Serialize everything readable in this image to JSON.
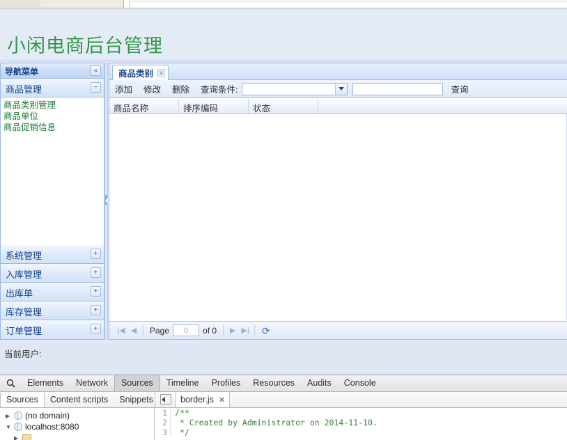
{
  "banner": {
    "title": "小闲电商后台管理",
    "title_color": "#2e9648"
  },
  "sidebar": {
    "header": {
      "title": "导航菜单",
      "collapse_icon": "«"
    },
    "expanded_group": {
      "title": "商品管理",
      "toggle_icon": "−",
      "links": [
        "商品类别管理",
        "商品单位",
        "商品促销信息"
      ]
    },
    "collapsed_groups": [
      {
        "title": "系统管理",
        "toggle_icon": "+"
      },
      {
        "title": "入库管理",
        "toggle_icon": "+"
      },
      {
        "title": "出库单",
        "toggle_icon": "+"
      },
      {
        "title": "库存管理",
        "toggle_icon": "+"
      },
      {
        "title": "订单管理",
        "toggle_icon": "+"
      }
    ]
  },
  "main": {
    "tab": {
      "label": "商品类别",
      "close_icon": "✕"
    },
    "toolbar": {
      "add_label": "添加",
      "edit_label": "修改",
      "delete_label": "删除",
      "query_condition_label": "查询条件:",
      "combo_value": "",
      "combo_placeholder": "",
      "keyword_value": "",
      "keyword_placeholder": "",
      "query_button_label": "查询"
    },
    "grid": {
      "columns": [
        "商品名称",
        "排序编码",
        "状态"
      ],
      "rows": []
    },
    "pager": {
      "first_icon": "|◀",
      "prev_icon": "◀",
      "page_label": "Page",
      "page_value": "0",
      "of_label": "of 0",
      "next_icon": "▶",
      "last_icon": "▶|",
      "refresh_icon": "⟳"
    }
  },
  "footer": {
    "current_user_label": "当前用户:"
  },
  "devtools": {
    "search_icon": "search-icon",
    "tabs": [
      {
        "label": "Elements",
        "active": false
      },
      {
        "label": "Network",
        "active": false
      },
      {
        "label": "Sources",
        "active": true
      },
      {
        "label": "Timeline",
        "active": false
      },
      {
        "label": "Profiles",
        "active": false
      },
      {
        "label": "Resources",
        "active": false
      },
      {
        "label": "Audits",
        "active": false
      },
      {
        "label": "Console",
        "active": false
      }
    ],
    "subtabs": [
      {
        "label": "Sources",
        "active": true
      },
      {
        "label": "Content scripts",
        "active": false
      },
      {
        "label": "Snippets",
        "active": false
      }
    ],
    "file_tab": {
      "label": "border.js",
      "close_icon": "✕"
    },
    "tree": [
      {
        "twisty": "▶",
        "icon": "globe-icon",
        "label": "(no domain)"
      },
      {
        "twisty": "▼",
        "icon": "globe-icon",
        "label": "localhost:8080"
      },
      {
        "twisty": "▶",
        "icon": "folder-icon",
        "label": ""
      }
    ],
    "code": [
      {
        "number": "1",
        "text": "/**"
      },
      {
        "number": "2",
        "text": " * Created by Administrator on 2014-11-10."
      },
      {
        "number": "3",
        "text": " */"
      }
    ]
  }
}
